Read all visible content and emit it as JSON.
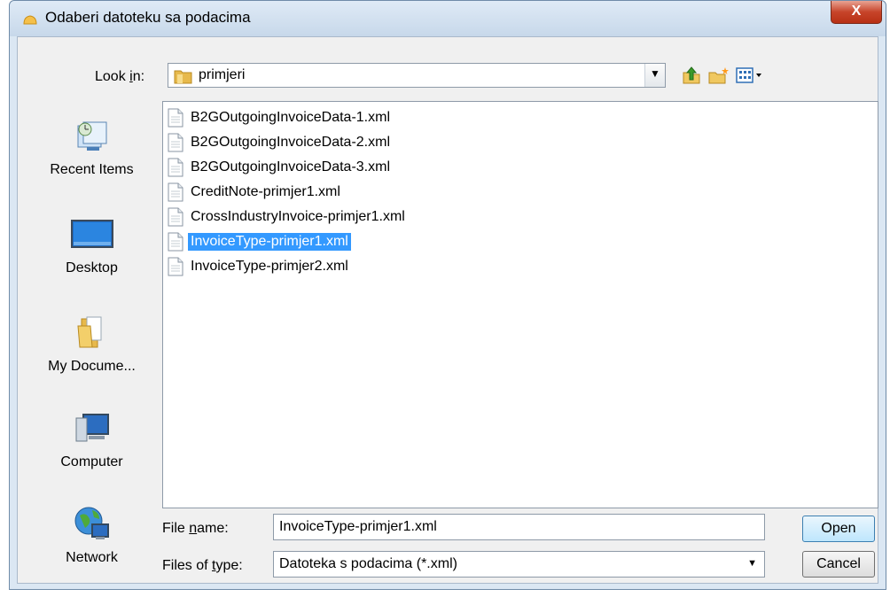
{
  "window": {
    "title": "Odaberi datoteku sa podacima",
    "close_glyph": "X"
  },
  "look_in": {
    "label": "Look in:",
    "accesskey": "i",
    "value": "primjeri"
  },
  "toolbar": {
    "up_icon": "up-folder-icon",
    "new_folder_icon": "new-folder-icon",
    "view_menu_icon": "view-menu-icon"
  },
  "places": [
    {
      "label": "Recent Items",
      "icon": "recent-items-icon"
    },
    {
      "label": "Desktop",
      "icon": "desktop-icon"
    },
    {
      "label": "My Docume...",
      "icon": "my-documents-icon"
    },
    {
      "label": "Computer",
      "icon": "computer-icon"
    },
    {
      "label": "Network",
      "icon": "network-icon"
    }
  ],
  "files": [
    {
      "name": "B2GOutgoingInvoiceData-1.xml",
      "selected": false
    },
    {
      "name": "B2GOutgoingInvoiceData-2.xml",
      "selected": false
    },
    {
      "name": "B2GOutgoingInvoiceData-3.xml",
      "selected": false
    },
    {
      "name": "CreditNote-primjer1.xml",
      "selected": false
    },
    {
      "name": "CrossIndustryInvoice-primjer1.xml",
      "selected": false
    },
    {
      "name": "InvoiceType-primjer1.xml",
      "selected": true
    },
    {
      "name": "InvoiceType-primjer2.xml",
      "selected": false
    }
  ],
  "file_name": {
    "label": "File name:",
    "accesskey": "n",
    "value": "InvoiceType-primjer1.xml"
  },
  "file_type": {
    "label": "Files of type:",
    "accesskey": "t",
    "value": "Datoteka s podacima (*.xml)"
  },
  "buttons": {
    "open": "Open",
    "cancel": "Cancel"
  },
  "colors": {
    "selection": "#3399ff",
    "close_button": "#c7442a",
    "title_bar": "#dbe7f3"
  }
}
